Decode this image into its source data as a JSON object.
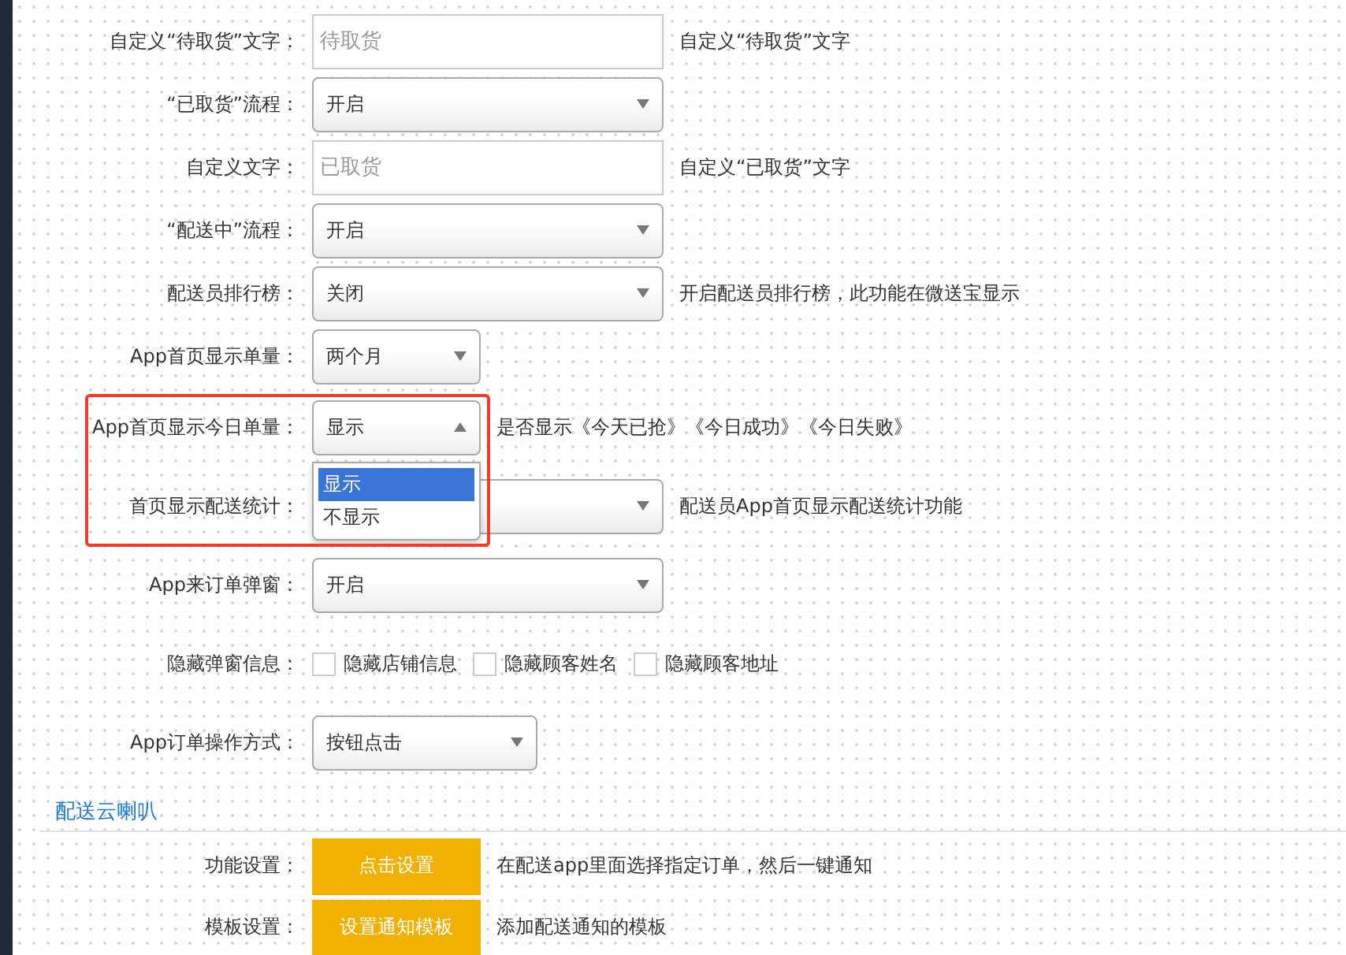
{
  "form_rows": [
    {
      "kind": "text",
      "label": "自定义“待取货”文字：",
      "placeholder": "待取货",
      "hint": "自定义“待取货”文字"
    },
    {
      "kind": "select",
      "label": "“已取货”流程：",
      "value": "开启"
    },
    {
      "kind": "text",
      "label": "自定义文字：",
      "placeholder": "已取货",
      "hint": "自定义“已取货”文字"
    },
    {
      "kind": "select",
      "label": "“配送中”流程：",
      "value": "开启"
    },
    {
      "kind": "select",
      "label": "配送员排行榜：",
      "value": "关闭",
      "hint": "开启配送员排行榜，此功能在微送宝显示"
    },
    {
      "kind": "select",
      "label": "App首页显示单量：",
      "value": "两个月"
    },
    {
      "kind": "select",
      "label": "App首页显示今日单量：",
      "value": "显示",
      "expanded": true,
      "hint": "是否显示《今天已抢》《今日成功》《今日失败》",
      "options": [
        {
          "label": "显示",
          "selected": true
        },
        {
          "label": "不显示",
          "selected": false
        }
      ]
    },
    {
      "kind": "select",
      "label": "首页显示配送统计：",
      "hint": "配送员App首页显示配送统计功能"
    },
    {
      "kind": "select",
      "label": "App来订单弹窗：",
      "value": "开启"
    },
    {
      "kind": "checkboxes",
      "label": "隐藏弹窗信息：",
      "items": [
        {
          "label": "隐藏店铺信息",
          "checked": false
        },
        {
          "label": "隐藏顾客姓名",
          "checked": false
        },
        {
          "label": "隐藏顾客地址",
          "checked": false
        }
      ]
    },
    {
      "kind": "select",
      "label": "App订单操作方式：",
      "value": "按钮点击"
    }
  ],
  "section": {
    "title": "配送云喇叭",
    "rows": [
      {
        "kind": "button",
        "label": "功能设置：",
        "button": "点击设置",
        "hint": "在配送app里面选择指定订单，然后一键通知"
      },
      {
        "kind": "button",
        "label": "模板设置：",
        "button": "设置通知模板",
        "hint": "添加配送通知的模板"
      }
    ]
  }
}
